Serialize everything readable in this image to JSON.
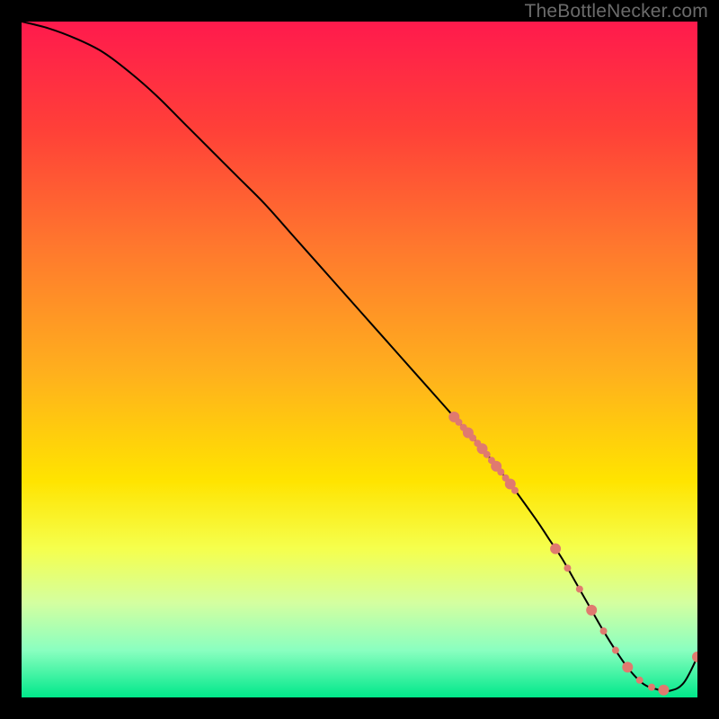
{
  "watermark": "TheBottleNecker.com",
  "chart_data": {
    "type": "line",
    "title": "",
    "xlabel": "",
    "ylabel": "",
    "xlim": [
      0,
      100
    ],
    "ylim": [
      0,
      100
    ],
    "gradient_stops": [
      {
        "pct": 0,
        "color": "#ff1a4d"
      },
      {
        "pct": 16,
        "color": "#ff4038"
      },
      {
        "pct": 34,
        "color": "#ff7a2d"
      },
      {
        "pct": 52,
        "color": "#ffb01d"
      },
      {
        "pct": 68,
        "color": "#ffe400"
      },
      {
        "pct": 78,
        "color": "#f5ff4d"
      },
      {
        "pct": 86,
        "color": "#d4ffa0"
      },
      {
        "pct": 93,
        "color": "#8affc0"
      },
      {
        "pct": 100,
        "color": "#00e88a"
      }
    ],
    "series": [
      {
        "name": "bottleneck-curve",
        "color": "#000000",
        "stroke_width": 2,
        "x": [
          0,
          4,
          8,
          12,
          16,
          20,
          24,
          28,
          32,
          36,
          40,
          44,
          48,
          52,
          56,
          60,
          64,
          68,
          72,
          76,
          78,
          80,
          82,
          84,
          86,
          88,
          90,
          92,
          94,
          96,
          98,
          100
        ],
        "values": [
          100,
          99,
          97.5,
          95.5,
          92.5,
          89,
          85,
          81,
          77,
          73,
          68.5,
          64,
          59.5,
          55,
          50.5,
          46,
          41.5,
          37,
          32,
          26.5,
          23.5,
          20.5,
          17,
          13.5,
          10,
          6.8,
          4,
          2,
          1.2,
          1,
          2.2,
          6
        ]
      }
    ],
    "markers": {
      "color": "#e07a6f",
      "radius_small": 4,
      "radius_large": 6,
      "clusters": [
        {
          "x_range": [
            64,
            73
          ],
          "count": 14,
          "along_curve": true
        },
        {
          "x_range": [
            79,
            95
          ],
          "count": 10,
          "along_curve": true
        }
      ],
      "final_point": {
        "x": 100,
        "y": 6
      }
    }
  }
}
